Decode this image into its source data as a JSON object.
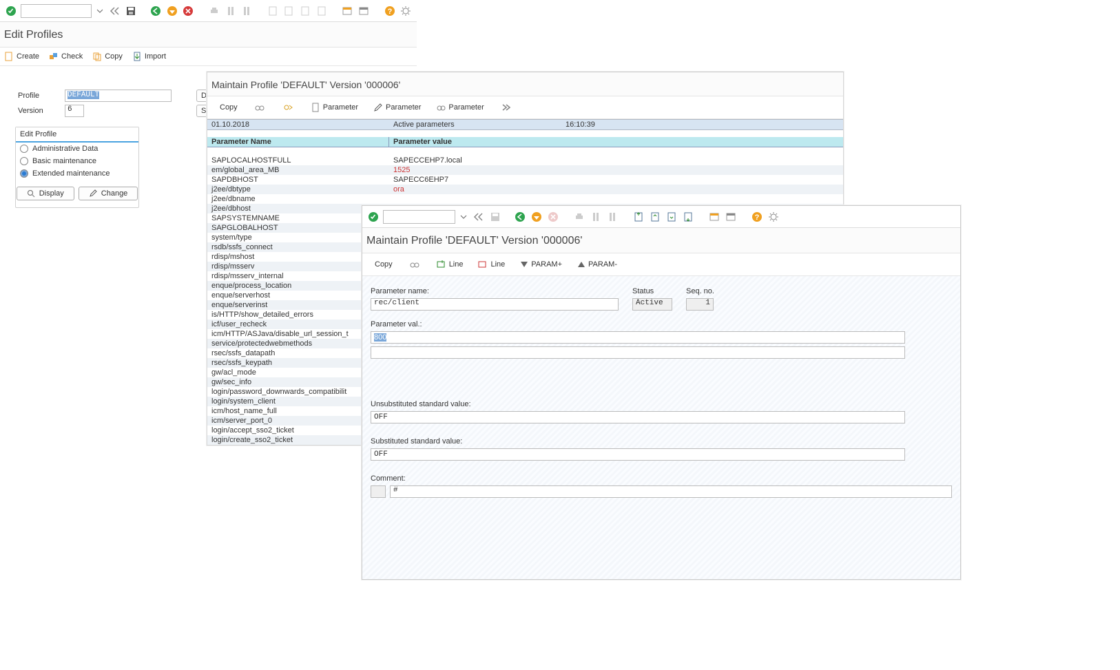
{
  "win1": {
    "title": "Edit Profiles",
    "toolbar_buttons": [
      "Create",
      "Check",
      "Copy",
      "Import"
    ],
    "profile_label": "Profile",
    "profile_value": "DEFAULT",
    "version_label": "Version",
    "version_value": "6",
    "trunc_btn1": "De",
    "trunc_btn2": "Sav",
    "group_title": "Edit Profile",
    "radio_options": [
      "Administrative Data",
      "Basic maintenance",
      "Extended maintenance"
    ],
    "radio_selected": 2,
    "btn_display": "Display",
    "btn_change": "Change"
  },
  "win2": {
    "title": "Maintain Profile 'DEFAULT' Version '000006'",
    "toolbar": {
      "copy": "Copy",
      "param": "Parameter"
    },
    "head_date": "01.10.2018",
    "head_title": "Active parameters",
    "head_time": "16:10:39",
    "col1": "Parameter Name",
    "col2": "Parameter value",
    "rows": [
      {
        "n": "SAPLOCALHOSTFULL",
        "v": "SAPECCEHP7.local",
        "red": false
      },
      {
        "n": "em/global_area_MB",
        "v": "1525",
        "red": true
      },
      {
        "n": "SAPDBHOST",
        "v": "SAPECC6EHP7",
        "red": false
      },
      {
        "n": "j2ee/dbtype",
        "v": "ora",
        "red": true
      },
      {
        "n": "j2ee/dbname",
        "v": ""
      },
      {
        "n": "j2ee/dbhost",
        "v": ""
      },
      {
        "n": "SAPSYSTEMNAME",
        "v": ""
      },
      {
        "n": "SAPGLOBALHOST",
        "v": ""
      },
      {
        "n": "system/type",
        "v": ""
      },
      {
        "n": "rsdb/ssfs_connect",
        "v": ""
      },
      {
        "n": "rdisp/mshost",
        "v": ""
      },
      {
        "n": "rdisp/msserv",
        "v": ""
      },
      {
        "n": "rdisp/msserv_internal",
        "v": ""
      },
      {
        "n": "enque/process_location",
        "v": ""
      },
      {
        "n": "enque/serverhost",
        "v": ""
      },
      {
        "n": "enque/serverinst",
        "v": ""
      },
      {
        "n": "is/HTTP/show_detailed_errors",
        "v": ""
      },
      {
        "n": "icf/user_recheck",
        "v": ""
      },
      {
        "n": "icm/HTTP/ASJava/disable_url_session_t",
        "v": ""
      },
      {
        "n": "service/protectedwebmethods",
        "v": ""
      },
      {
        "n": "rsec/ssfs_datapath",
        "v": ""
      },
      {
        "n": "rsec/ssfs_keypath",
        "v": ""
      },
      {
        "n": "gw/acl_mode",
        "v": ""
      },
      {
        "n": "gw/sec_info",
        "v": ""
      },
      {
        "n": "login/password_downwards_compatibilit",
        "v": ""
      },
      {
        "n": "login/system_client",
        "v": ""
      },
      {
        "n": "icm/host_name_full",
        "v": ""
      },
      {
        "n": "icm/server_port_0",
        "v": ""
      },
      {
        "n": "login/accept_sso2_ticket",
        "v": ""
      },
      {
        "n": "login/create_sso2_ticket",
        "v": ""
      }
    ]
  },
  "win3": {
    "title": "Maintain Profile 'DEFAULT' Version '000006'",
    "toolbar": {
      "copy": "Copy",
      "line": "Line",
      "param_plus": "PARAM+",
      "param_minus": "PARAM-"
    },
    "lbl_param_name": "Parameter name:",
    "param_name": "rec/client",
    "lbl_status": "Status",
    "status": "Active",
    "lbl_seq": "Seq. no.",
    "seq": "1",
    "lbl_param_val": "Parameter val.:",
    "param_val": "800",
    "lbl_unsub": "Unsubstituted standard value:",
    "unsub_val": "OFF",
    "lbl_sub": "Substituted standard value:",
    "sub_val": "OFF",
    "lbl_comment": "Comment:",
    "comment": "#"
  }
}
